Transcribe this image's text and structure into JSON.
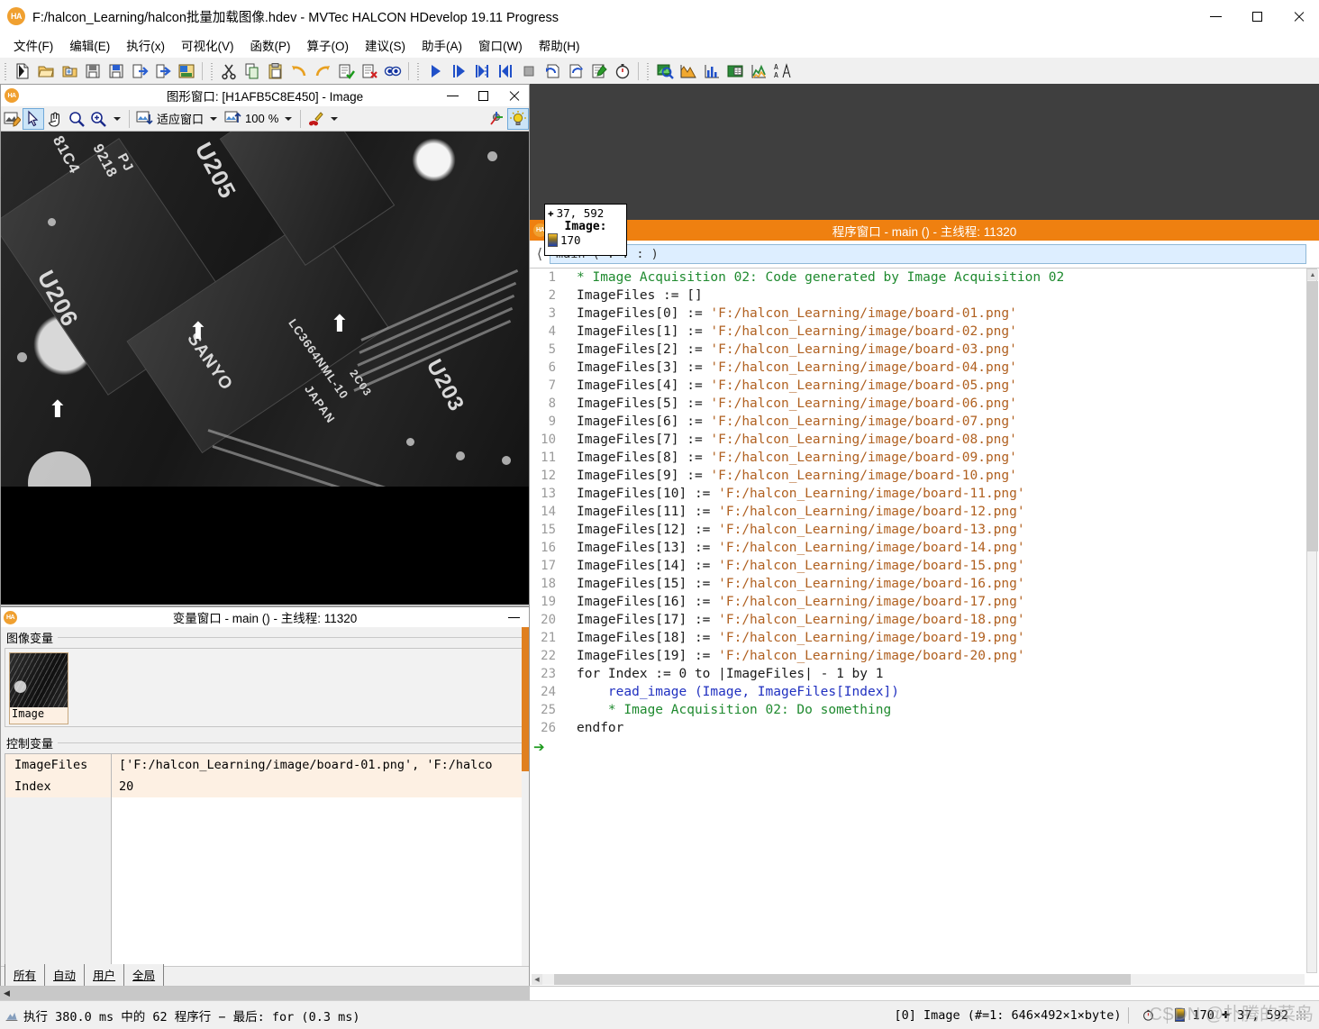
{
  "window": {
    "title": "F:/halcon_Learning/halcon批量加载图像.hdev - MVTec HALCON HDevelop 19.11 Progress",
    "logo": "HA",
    "minimize": "minimize-icon",
    "maximize": "maximize-icon",
    "close": "close-icon"
  },
  "menubar": {
    "items": [
      {
        "label": "文件(F)"
      },
      {
        "label": "编辑(E)"
      },
      {
        "label": "执行(x)"
      },
      {
        "label": "可视化(V)"
      },
      {
        "label": "函数(P)"
      },
      {
        "label": "算子(O)"
      },
      {
        "label": "建议(S)"
      },
      {
        "label": "助手(A)"
      },
      {
        "label": "窗口(W)"
      },
      {
        "label": "帮助(H)"
      }
    ]
  },
  "toolbar": {
    "groups": [
      [
        "new-program-icon",
        "open-program-icon",
        "open-recent-icon",
        "save-program-icon",
        "save-as-icon",
        "import-icon",
        "export-icon",
        "assistants-icon"
      ],
      [
        "cut-icon",
        "copy-icon",
        "paste-icon",
        "undo-icon",
        "redo-icon",
        "activate-line-icon",
        "deactivate-line-icon",
        "view-eyes-icon"
      ],
      [
        "run-icon",
        "step-over-icon",
        "step-into-icon",
        "step-out-icon",
        "stop-icon",
        "reset-program-icon",
        "reload-icon",
        "edit-procedure-icon",
        "stopwatch-icon"
      ],
      [
        "image-inspect-icon",
        "gray-histogram-icon",
        "histogram-icon",
        "feature-inspect-icon",
        "profile-icon",
        "text-compare-icon"
      ]
    ]
  },
  "graphics_window": {
    "title": "图形窗口: [H1AFB5C8E450] - Image",
    "logo": "HA",
    "minimize": "minimize-icon",
    "maximize": "maximize-icon",
    "close": "close-icon",
    "toolbar": {
      "draw_icon": "draw-mode-icon",
      "select_icon": "select-arrow-icon",
      "pan_icon": "pan-hand-icon",
      "zoom_icon": "magnifier-icon",
      "zoom_in_icon": "magnifier-plus-icon",
      "fit_icon": "fit-window-icon",
      "fit_label": "适应窗口",
      "zoom_level_icon": "zoom-level-icon",
      "zoom_level_label": "100",
      "zoom_percent": "%",
      "color_icon": "color-palette-icon",
      "axes_icon": "coordinate-axes-icon",
      "lighting_icon": "lighting-bulb-icon"
    }
  },
  "tooltip": {
    "cursor_icon": "crosshair-cursor-icon",
    "coordinates": "37, 592",
    "label": "Image:",
    "gray_value": "170",
    "swatch_icon": "color-gradient-swatch-icon"
  },
  "variable_window": {
    "title": "变量窗口 - main () - 主线程: 11320",
    "logo": "HA",
    "minimize": "minimize-icon",
    "iconic_group": "图像变量",
    "control_group": "控制变量",
    "iconic_vars": [
      {
        "name": "Image"
      }
    ],
    "control_vars": [
      {
        "name": "ImageFiles",
        "value": "['F:/halcon_Learning/image/board-01.png', 'F:/halco"
      },
      {
        "name": "Index",
        "value": "20"
      }
    ],
    "tabs": [
      {
        "label": "所有"
      },
      {
        "label": "自动"
      },
      {
        "label": "用户"
      },
      {
        "label": "全局"
      }
    ]
  },
  "program_window": {
    "title": "程序窗口 - main () - 主线程: 11320",
    "logo": "HA",
    "procedure_signature": "main ( : : : )",
    "back_icon": "back-arrow-icon",
    "exec_marker_icon": "execution-arrow-icon",
    "code": [
      {
        "n": "1",
        "tokens": [
          {
            "t": "* Image Acquisition 02: Code generated by Image Acquisition 02",
            "c": "c-comment"
          }
        ]
      },
      {
        "n": "2",
        "tokens": [
          {
            "t": "ImageFiles := []",
            "c": "c-var"
          }
        ]
      },
      {
        "n": "3",
        "tokens": [
          {
            "t": "ImageFiles[0] := ",
            "c": "c-var"
          },
          {
            "t": "'F:/halcon_Learning/image/board-01.png'",
            "c": "c-str"
          }
        ]
      },
      {
        "n": "4",
        "tokens": [
          {
            "t": "ImageFiles[1] := ",
            "c": "c-var"
          },
          {
            "t": "'F:/halcon_Learning/image/board-02.png'",
            "c": "c-str"
          }
        ]
      },
      {
        "n": "5",
        "tokens": [
          {
            "t": "ImageFiles[2] := ",
            "c": "c-var"
          },
          {
            "t": "'F:/halcon_Learning/image/board-03.png'",
            "c": "c-str"
          }
        ]
      },
      {
        "n": "6",
        "tokens": [
          {
            "t": "ImageFiles[3] := ",
            "c": "c-var"
          },
          {
            "t": "'F:/halcon_Learning/image/board-04.png'",
            "c": "c-str"
          }
        ]
      },
      {
        "n": "7",
        "tokens": [
          {
            "t": "ImageFiles[4] := ",
            "c": "c-var"
          },
          {
            "t": "'F:/halcon_Learning/image/board-05.png'",
            "c": "c-str"
          }
        ]
      },
      {
        "n": "8",
        "tokens": [
          {
            "t": "ImageFiles[5] := ",
            "c": "c-var"
          },
          {
            "t": "'F:/halcon_Learning/image/board-06.png'",
            "c": "c-str"
          }
        ]
      },
      {
        "n": "9",
        "tokens": [
          {
            "t": "ImageFiles[6] := ",
            "c": "c-var"
          },
          {
            "t": "'F:/halcon_Learning/image/board-07.png'",
            "c": "c-str"
          }
        ]
      },
      {
        "n": "10",
        "tokens": [
          {
            "t": "ImageFiles[7] := ",
            "c": "c-var"
          },
          {
            "t": "'F:/halcon_Learning/image/board-08.png'",
            "c": "c-str"
          }
        ]
      },
      {
        "n": "11",
        "tokens": [
          {
            "t": "ImageFiles[8] := ",
            "c": "c-var"
          },
          {
            "t": "'F:/halcon_Learning/image/board-09.png'",
            "c": "c-str"
          }
        ]
      },
      {
        "n": "12",
        "tokens": [
          {
            "t": "ImageFiles[9] := ",
            "c": "c-var"
          },
          {
            "t": "'F:/halcon_Learning/image/board-10.png'",
            "c": "c-str"
          }
        ]
      },
      {
        "n": "13",
        "tokens": [
          {
            "t": "ImageFiles[10] := ",
            "c": "c-var"
          },
          {
            "t": "'F:/halcon_Learning/image/board-11.png'",
            "c": "c-str"
          }
        ]
      },
      {
        "n": "14",
        "tokens": [
          {
            "t": "ImageFiles[11] := ",
            "c": "c-var"
          },
          {
            "t": "'F:/halcon_Learning/image/board-12.png'",
            "c": "c-str"
          }
        ]
      },
      {
        "n": "15",
        "tokens": [
          {
            "t": "ImageFiles[12] := ",
            "c": "c-var"
          },
          {
            "t": "'F:/halcon_Learning/image/board-13.png'",
            "c": "c-str"
          }
        ]
      },
      {
        "n": "16",
        "tokens": [
          {
            "t": "ImageFiles[13] := ",
            "c": "c-var"
          },
          {
            "t": "'F:/halcon_Learning/image/board-14.png'",
            "c": "c-str"
          }
        ]
      },
      {
        "n": "17",
        "tokens": [
          {
            "t": "ImageFiles[14] := ",
            "c": "c-var"
          },
          {
            "t": "'F:/halcon_Learning/image/board-15.png'",
            "c": "c-str"
          }
        ]
      },
      {
        "n": "18",
        "tokens": [
          {
            "t": "ImageFiles[15] := ",
            "c": "c-var"
          },
          {
            "t": "'F:/halcon_Learning/image/board-16.png'",
            "c": "c-str"
          }
        ]
      },
      {
        "n": "19",
        "tokens": [
          {
            "t": "ImageFiles[16] := ",
            "c": "c-var"
          },
          {
            "t": "'F:/halcon_Learning/image/board-17.png'",
            "c": "c-str"
          }
        ]
      },
      {
        "n": "20",
        "tokens": [
          {
            "t": "ImageFiles[17] := ",
            "c": "c-var"
          },
          {
            "t": "'F:/halcon_Learning/image/board-18.png'",
            "c": "c-str"
          }
        ]
      },
      {
        "n": "21",
        "tokens": [
          {
            "t": "ImageFiles[18] := ",
            "c": "c-var"
          },
          {
            "t": "'F:/halcon_Learning/image/board-19.png'",
            "c": "c-str"
          }
        ]
      },
      {
        "n": "22",
        "tokens": [
          {
            "t": "ImageFiles[19] := ",
            "c": "c-var"
          },
          {
            "t": "'F:/halcon_Learning/image/board-20.png'",
            "c": "c-str"
          }
        ]
      },
      {
        "n": "23",
        "tokens": [
          {
            "t": "for Index := 0 to |ImageFiles| - 1 by 1",
            "c": "c-kw"
          }
        ]
      },
      {
        "n": "24",
        "tokens": [
          {
            "t": "    read_image (Image, ImageFiles[Index])",
            "c": "c-call"
          }
        ]
      },
      {
        "n": "25",
        "tokens": [
          {
            "t": "    * Image Acquisition 02: Do something",
            "c": "c-comment"
          }
        ]
      },
      {
        "n": "26",
        "tokens": [
          {
            "t": "endfor",
            "c": "c-kw"
          }
        ]
      }
    ]
  },
  "statusbar": {
    "exec_icon": "execution-status-icon",
    "message": "执行 380.0 ms 中的 62 程序行 − 最后: for (0.3 ms)",
    "image_info": "[0] Image (#=1: 646×492×1×byte)",
    "stopwatch_icon": "stopwatch-icon",
    "swatch_icon": "color-gradient-swatch-icon",
    "gray_value": "170",
    "cursor_icon": "crosshair-cursor-icon",
    "coordinates": "37, 592",
    "resize_grip": "resize-grip-icon"
  },
  "watermark": {
    "text": "CSDN @扑腾的菜鸟"
  },
  "colors": {
    "program_title_bg": "#ef8010",
    "accent_orange": "#e08020",
    "comment_green": "#1f8a2f",
    "string_brown": "#b06020",
    "call_blue": "#2030c0"
  }
}
